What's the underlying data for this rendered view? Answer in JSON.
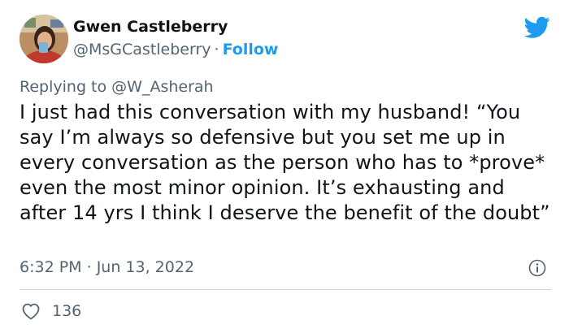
{
  "author": {
    "name": "Gwen Castleberry",
    "handle": "@MsGCastleberry",
    "separator": "·",
    "follow_label": "Follow"
  },
  "reply": {
    "prefix": "Replying to",
    "mention": "@W_Asherah"
  },
  "tweet": {
    "text": "I just had this conversation with my husband! “You say I’m always so defensive but you set me up in every conversation as the person who has to *prove* even the most minor opinion. It’s exhausting and after 14 yrs I think I deserve the benefit of the doubt”",
    "time": "6:32 PM",
    "separator": "·",
    "date": "Jun 13, 2022"
  },
  "engagement": {
    "likes": "136"
  },
  "colors": {
    "accent": "#1d9bf0",
    "muted": "#536471",
    "text": "#0f1419",
    "divider": "#cfd9de"
  },
  "icons": {
    "brand": "twitter-bird-icon",
    "info": "info-icon",
    "like": "heart-icon"
  }
}
